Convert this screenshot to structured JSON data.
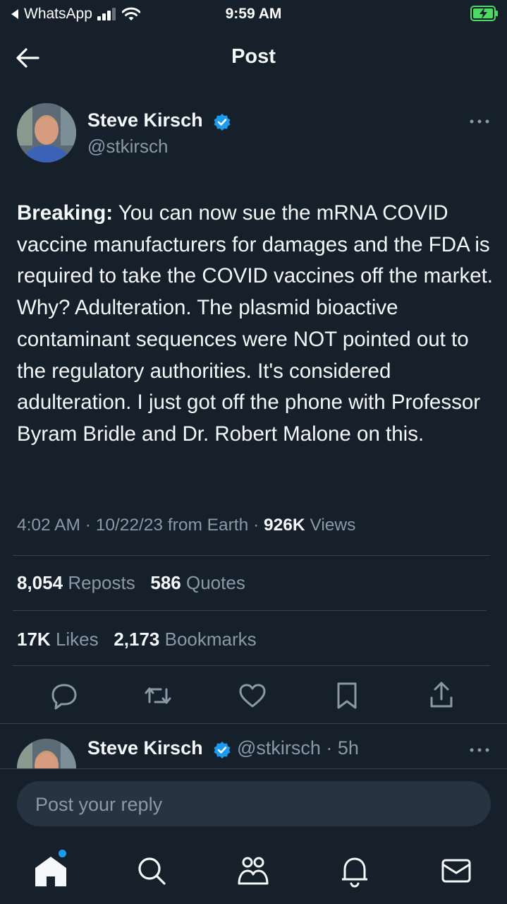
{
  "status_bar": {
    "back_app": "WhatsApp",
    "time": "9:59 AM"
  },
  "header": {
    "title": "Post"
  },
  "post": {
    "author_name": "Steve Kirsch",
    "author_handle": "@stkirsch",
    "text_bold": "Breaking:",
    "text": "You can now sue the mRNA COVID vaccine manufacturers for damages and the FDA is required to take the COVID vaccines off the market. Why? Adulteration. The plasmid bioactive contaminant sequences were NOT pointed out to the regulatory authorities. It's considered adulteration. I just got off the phone with Professor Byram Bridle and Dr. Robert Malone on this.",
    "time": "4:02 AM",
    "sep1": "·",
    "date": "10/22/23",
    "source": "from Earth",
    "sep2": "·",
    "views_count": "926K",
    "views_label": "Views"
  },
  "stats": {
    "reposts_count": "8,054",
    "reposts_label": "Reposts",
    "quotes_count": "586",
    "quotes_label": "Quotes",
    "likes_count": "17K",
    "likes_label": "Likes",
    "bookmarks_count": "2,173",
    "bookmarks_label": "Bookmarks"
  },
  "reply_preview": {
    "author_name": "Steve Kirsch",
    "handle_time": "@stkirsch · 5h"
  },
  "composer": {
    "placeholder": "Post your reply"
  },
  "colors": {
    "background": "#15202b",
    "accent": "#1d9bf0",
    "muted_text": "#8b98a5",
    "divider": "#38444d",
    "battery": "#4cd964"
  },
  "icons": {
    "tabs": [
      "home-icon",
      "search-icon",
      "communities-icon",
      "notifications-icon",
      "messages-icon"
    ],
    "actions": [
      "reply-icon",
      "repost-icon",
      "like-icon",
      "bookmark-icon",
      "share-icon"
    ]
  }
}
